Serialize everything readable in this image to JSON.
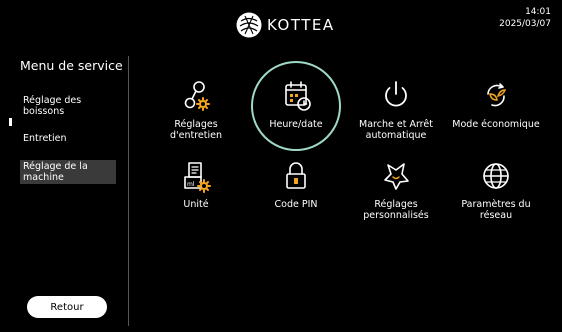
{
  "header": {
    "brand": "KOTTEA",
    "time": "14:01",
    "date": "2025/03/07"
  },
  "sidebar": {
    "title": "Menu de service",
    "items": [
      {
        "label": "Réglage des boissons",
        "active": false
      },
      {
        "label": "Entretien",
        "active": false
      },
      {
        "label": "Réglage de la machine",
        "active": true
      }
    ],
    "back_label": "Retour"
  },
  "grid": {
    "tiles": [
      {
        "label": "Réglages d'entretien",
        "icon": "maintenance-settings-icon",
        "focused": false
      },
      {
        "label": "Heure/date",
        "icon": "calendar-clock-icon",
        "focused": true
      },
      {
        "label": "Marche et Arrêt automatique",
        "icon": "power-icon",
        "focused": false
      },
      {
        "label": "Mode économique",
        "icon": "eco-leaf-icon",
        "focused": false
      },
      {
        "label": "Unité",
        "icon": "unit-icon",
        "focused": false
      },
      {
        "label": "Code PIN",
        "icon": "lock-icon",
        "focused": false
      },
      {
        "label": "Réglages personnalisés",
        "icon": "star-icon",
        "focused": false
      },
      {
        "label": "Paramètres du réseau",
        "icon": "globe-icon",
        "focused": false
      }
    ]
  },
  "colors": {
    "background": "#000000",
    "accent": "#f2a51e",
    "focus_ring": "#9fd9c6",
    "active_item": "#3a3a3a"
  }
}
